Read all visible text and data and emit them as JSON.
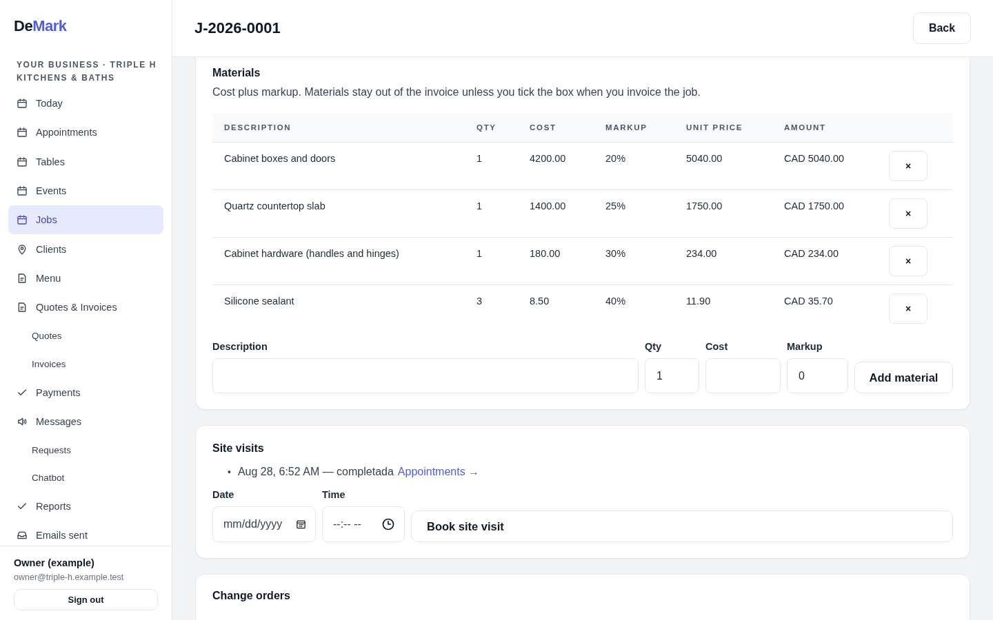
{
  "brand": {
    "parts": [
      {
        "text": "De",
        "accent": false
      },
      {
        "text": "Mark",
        "accent": true
      }
    ]
  },
  "sidebar": {
    "business": "YOUR BUSINESS · TRIPLE H KITCHENS & BATHS",
    "items": [
      {
        "label": "Today",
        "kind": "item",
        "selected": false
      },
      {
        "label": "Appointments",
        "kind": "item",
        "selected": false
      },
      {
        "label": "Tables",
        "kind": "item",
        "selected": false
      },
      {
        "label": "Events",
        "kind": "item",
        "selected": false
      },
      {
        "label": "Jobs",
        "kind": "item",
        "selected": true
      },
      {
        "label": "Clients",
        "kind": "item",
        "selected": false
      },
      {
        "label": "Menu",
        "kind": "item",
        "selected": false
      },
      {
        "label": "Quotes & Invoices",
        "kind": "item",
        "selected": false
      },
      {
        "label": "Quotes",
        "kind": "subitem",
        "selected": false
      },
      {
        "label": "Invoices",
        "kind": "subitem",
        "selected": false
      },
      {
        "label": "Payments",
        "kind": "item",
        "selected": false
      },
      {
        "label": "Messages",
        "kind": "item",
        "selected": false
      },
      {
        "label": "Requests",
        "kind": "subitem",
        "selected": false
      },
      {
        "label": "Chatbot",
        "kind": "subitem",
        "selected": false
      },
      {
        "label": "Reports",
        "kind": "item",
        "selected": false
      },
      {
        "label": "Emails sent",
        "kind": "item",
        "selected": false
      }
    ],
    "user": {
      "name": "Owner (example)",
      "email": "owner@triple-h.example.test",
      "sign_out": "Sign out"
    }
  },
  "header": {
    "title": "J-2026-0001",
    "back": "Back"
  },
  "materials": {
    "title": "Materials",
    "description": "Cost plus markup. Materials stay out of the invoice unless you tick the box when you invoice the job.",
    "columns": [
      "DESCRIPTION",
      "QTY",
      "COST",
      "MARKUP",
      "UNIT PRICE",
      "AMOUNT"
    ],
    "rows": [
      {
        "cells": [
          "Cabinet boxes and doors",
          "1",
          "4200.00",
          "20%",
          "5040.00",
          "CAD 5040.00"
        ],
        "remove": "×"
      },
      {
        "cells": [
          "Quartz countertop slab",
          "1",
          "1400.00",
          "25%",
          "1750.00",
          "CAD 1750.00"
        ],
        "remove": "×"
      },
      {
        "cells": [
          "Cabinet hardware (handles and hinges)",
          "1",
          "180.00",
          "30%",
          "234.00",
          "CAD 234.00"
        ],
        "remove": "×"
      },
      {
        "cells": [
          "Silicone sealant",
          "3",
          "8.50",
          "40%",
          "11.90",
          "CAD 35.70"
        ],
        "remove": "×"
      }
    ],
    "form": {
      "fields": [
        {
          "label": "Description"
        },
        {
          "label": "Qty",
          "value": "1"
        },
        {
          "label": "Cost"
        },
        {
          "label": "Markup",
          "value": "0"
        }
      ],
      "button": "Add material"
    }
  },
  "site_visits": {
    "title": "Site visits",
    "visits": [
      {
        "bullet": "•",
        "text": "Aug 28, 6:52 AM — completada",
        "link": "Appointments →"
      }
    ],
    "date": {
      "label": "Date",
      "placeholder": "mm/dd/yyyy"
    },
    "time": {
      "label": "Time",
      "placeholder": "--:-- --"
    },
    "button": "Book site visit"
  },
  "change_orders": {
    "title": "Change orders"
  }
}
